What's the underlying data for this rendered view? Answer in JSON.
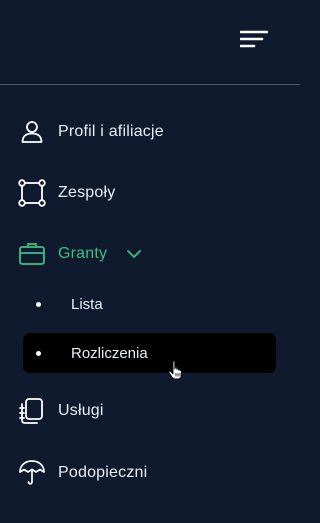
{
  "header": {
    "menu_icon": "hamburger-menu-icon"
  },
  "nav": {
    "items": [
      {
        "label": "Profil i afiliacje",
        "icon": "user-icon"
      },
      {
        "label": "Zespoły",
        "icon": "team-square-icon"
      },
      {
        "label": "Granty",
        "icon": "briefcase-icon",
        "expanded": true,
        "active": true,
        "children": [
          {
            "label": "Lista"
          },
          {
            "label": "Rozliczenia",
            "hovered": true
          }
        ]
      },
      {
        "label": "Usługi",
        "icon": "documents-icon"
      },
      {
        "label": "Podopieczni",
        "icon": "umbrella-icon"
      }
    ]
  },
  "colors": {
    "background": "#101a2e",
    "accent": "#3fbe83",
    "text": "#e9edf5",
    "hover_background": "#000000"
  }
}
